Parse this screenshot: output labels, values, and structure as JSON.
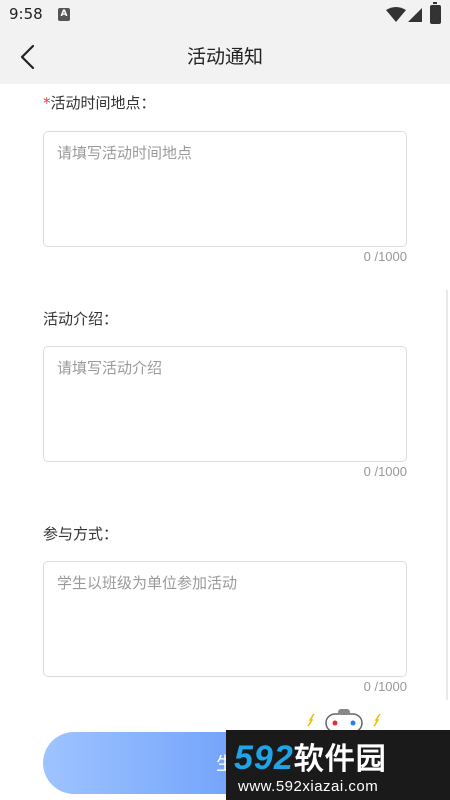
{
  "status_bar": {
    "time": "9:58",
    "notification_letter": "A"
  },
  "header": {
    "title": "活动通知",
    "back_icon": "chevron-left-icon"
  },
  "form": {
    "fields": [
      {
        "required_mark": "*",
        "label": "活动时间地点：",
        "value": "",
        "placeholder": "请填写活动时间地点",
        "counter": "0 /1000"
      },
      {
        "required_mark": "",
        "label": "活动介绍：",
        "value": "",
        "placeholder": "请填写活动介绍",
        "counter": "0 /1000"
      },
      {
        "required_mark": "",
        "label": "参与方式：",
        "value": "",
        "placeholder": "学生以班级为单位参加活动",
        "counter": "0 /1000"
      }
    ]
  },
  "submit_button": {
    "label": "生"
  },
  "watermark": {
    "digits": "592",
    "brand": "软件园",
    "url": "www.592xiazai.com"
  },
  "colors": {
    "accent_start": "#9ec4ff",
    "accent_end": "#4d86f7",
    "required": "#e0403a",
    "header_bg": "#f2f2f2"
  }
}
